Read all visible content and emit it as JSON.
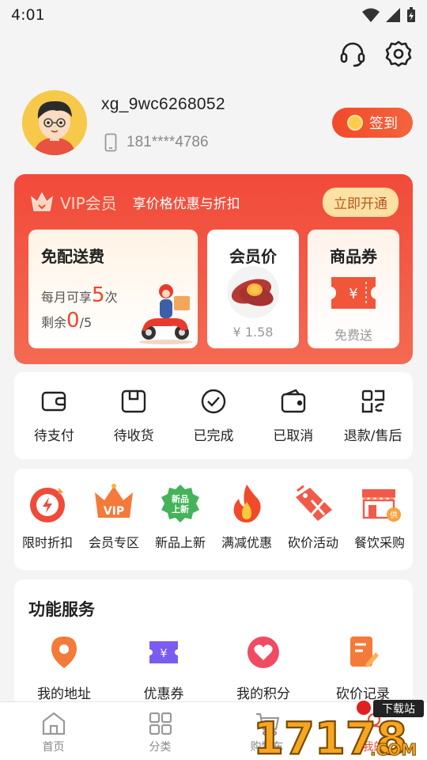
{
  "status": {
    "time": "4:01"
  },
  "profile": {
    "username": "xg_9wc6268052",
    "phone": "181****4786",
    "signin_label": "签到"
  },
  "vip": {
    "title": "VIP会员",
    "desc": "享价格优惠与折扣",
    "open_label": "立即开通",
    "delivery": {
      "title": "免配送费",
      "monthly_prefix": "每月可享",
      "monthly_count": "5",
      "monthly_suffix": "次",
      "remain_prefix": "剩余",
      "remain_count": "0",
      "remain_total": "/5"
    },
    "member_price": {
      "title": "会员价",
      "price": "¥ 1.58"
    },
    "coupon": {
      "title": "商品券",
      "sub": "免费送"
    }
  },
  "orders": [
    {
      "label": "待支付",
      "icon": "wallet-icon"
    },
    {
      "label": "待收货",
      "icon": "package-icon"
    },
    {
      "label": "已完成",
      "icon": "check-circle-icon"
    },
    {
      "label": "已取消",
      "icon": "wallet-cancel-icon"
    },
    {
      "label": "退款/售后",
      "icon": "refund-icon"
    }
  ],
  "promos": [
    {
      "label": "限时折扣",
      "icon": "flash-sale-icon"
    },
    {
      "label": "会员专区",
      "icon": "vip-crown-icon"
    },
    {
      "label": "新品上新",
      "icon": "new-badge-icon",
      "badge_text": "新品\n上新"
    },
    {
      "label": "满减优惠",
      "icon": "flame-icon"
    },
    {
      "label": "砍价活动",
      "icon": "scissors-tag-icon"
    },
    {
      "label": "餐饮采购",
      "icon": "store-icon",
      "badge": "供"
    }
  ],
  "services": {
    "title": "功能服务",
    "items": [
      {
        "label": "我的地址",
        "icon": "location-pin-icon"
      },
      {
        "label": "优惠券",
        "icon": "coupon-icon"
      },
      {
        "label": "我的积分",
        "icon": "heart-points-icon"
      },
      {
        "label": "砍价记录",
        "icon": "edit-record-icon"
      }
    ]
  },
  "tabbar": [
    {
      "label": "首页",
      "icon": "home-icon"
    },
    {
      "label": "分类",
      "icon": "grid-icon"
    },
    {
      "label": "购物车",
      "icon": "cart-icon"
    },
    {
      "label": "我的",
      "icon": "user-icon"
    }
  ],
  "watermark": {
    "text": "17178",
    "dotcom": ".COM",
    "tag": "下载站"
  },
  "colors": {
    "accent": "#f14a2a",
    "vip_gold": "#fde0a4",
    "background": "#f4f4f4"
  }
}
